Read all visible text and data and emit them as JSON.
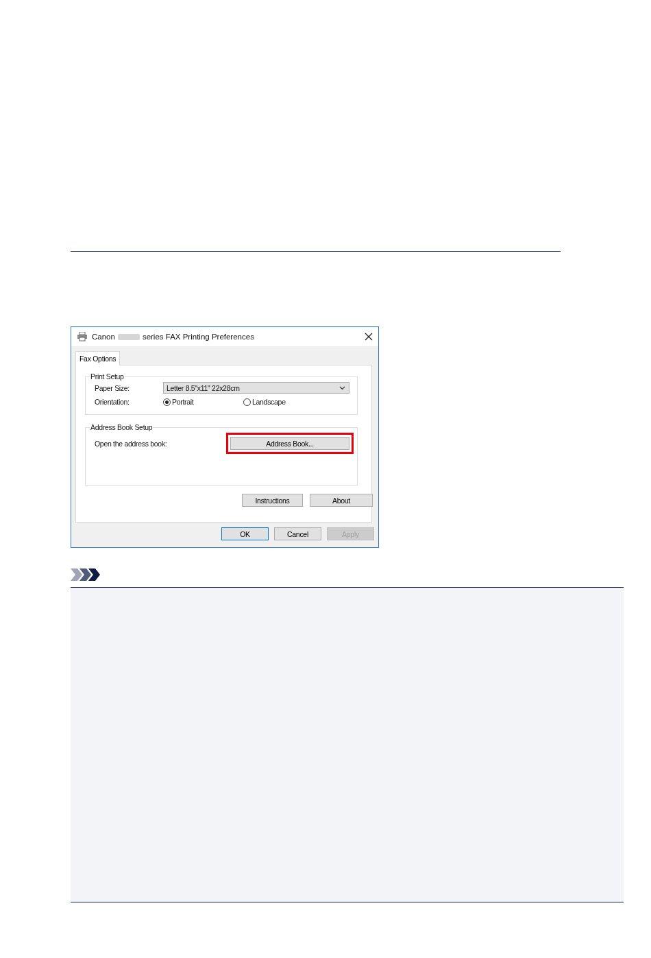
{
  "window": {
    "title_prefix": "Canon",
    "title_suffix": "series FAX Printing Preferences"
  },
  "tabs": [
    {
      "label": "Fax Options",
      "selected": true
    }
  ],
  "print_setup": {
    "title": "Print Setup",
    "paper_size_label": "Paper Size:",
    "paper_size_value": "Letter 8.5\"x11\" 22x28cm",
    "orientation_label": "Orientation:",
    "orientation_options": [
      {
        "label": "Portrait",
        "selected": true
      },
      {
        "label": "Landscape",
        "selected": false
      }
    ]
  },
  "address_book_setup": {
    "title": "Address Book Setup",
    "label": "Open the address book:",
    "button": "Address Book...",
    "highlighted": true
  },
  "panel_buttons": [
    "Instructions",
    "About"
  ],
  "dialog_buttons": [
    {
      "label": "OK",
      "default": true,
      "disabled": false
    },
    {
      "label": "Cancel",
      "default": false,
      "disabled": false
    },
    {
      "label": "Apply",
      "default": false,
      "disabled": true
    }
  ]
}
